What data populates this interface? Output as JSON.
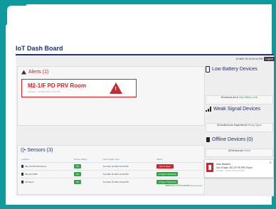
{
  "app": {
    "title": "IoT Dash Board"
  },
  "userbar": {
    "welcome": "10 MAY 29 12:02:04 PM",
    "logout_label": "Logout"
  },
  "alerts": {
    "heading": "Alerts (1)",
    "item": {
      "name": "M2-1/F PD PRV Room",
      "subtitle": "Humidity · 10 May 2021 12:02 PM"
    }
  },
  "sensors": {
    "heading": "Sensors (3)",
    "columns": [
      "Location",
      "Device Status",
      "Last Update Time",
      "Status"
    ],
    "rows": [
      {
        "location": "M2-1/F PD PRV Room",
        "device_status": "OK",
        "updated": "Tue Mar 11 2021 12:02 PM",
        "status": "Out of Spec",
        "status_color": "#d2242a"
      },
      {
        "location": "M2-1/F LPRV",
        "device_status": "OK",
        "updated": "Tue Mar 11 2021 12:02 PM",
        "status": "In Spec Threshold",
        "status_color": "#35a348"
      },
      {
        "location": "Lift Room",
        "device_status": "OK",
        "updated": "Tue Mar 11 2021 12:02 PM",
        "status": "In Spec Threshold",
        "status_color": "#35a348"
      }
    ]
  },
  "battery": {
    "heading": "Low Battery Devices",
    "text_prefix": "All sensors are in",
    "text_highlight": "High Battery Level"
  },
  "signal": {
    "heading": "Weak Signal Devices",
    "text_prefix": "All locations are Supported by",
    "text_highlight": "Strong Signal"
  },
  "offline": {
    "heading": "Offline Devices (0)",
    "text_prefix": "All Devices are",
    "text_highlight": "Online"
  },
  "notification": {
    "title": "User Mesanet",
    "text": "Out of Spec: M2-1/F PD PRV Room",
    "subtext": "Humidity · 10 May 2021 12:02 PM",
    "controls": "✕"
  },
  "footer": {
    "text": "SMARTCITY IOT PLATFORM",
    "link": "www.ioteg.com"
  },
  "colors": {
    "frame": "#0f9a9e",
    "title": "#22306b",
    "alert": "#d2242a",
    "ok": "#35a348"
  }
}
